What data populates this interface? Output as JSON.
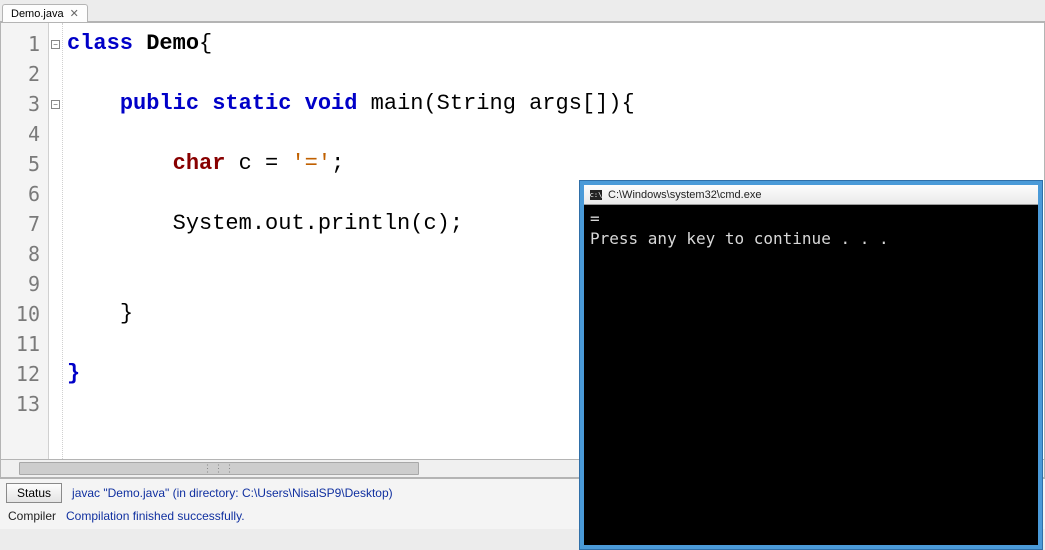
{
  "tab": {
    "filename": "Demo.java"
  },
  "editor": {
    "line_count": 13,
    "code": {
      "l1": {
        "kw1": "class",
        "cls": "Demo",
        "br": "{"
      },
      "l3": {
        "kw1": "public",
        "kw2": "static",
        "kw3": "void",
        "fn": "main",
        "rest": "(String args[]){"
      },
      "l5": {
        "typ": "char",
        "var": " c = ",
        "str": "'='",
        "semi": ";"
      },
      "l7": {
        "txt": "System.out.println(c);"
      },
      "l10": {
        "br": "}"
      },
      "l12": {
        "br": "}"
      }
    }
  },
  "bottom": {
    "status_btn": "Status",
    "compile_cmd": "javac \"Demo.java\" (in directory: C:\\Users\\NisalSP9\\Desktop)",
    "compiler_label": "Compiler",
    "success_msg": "Compilation finished successfully."
  },
  "console": {
    "title": "C:\\Windows\\system32\\cmd.exe",
    "output": "=\nPress any key to continue . . ."
  }
}
